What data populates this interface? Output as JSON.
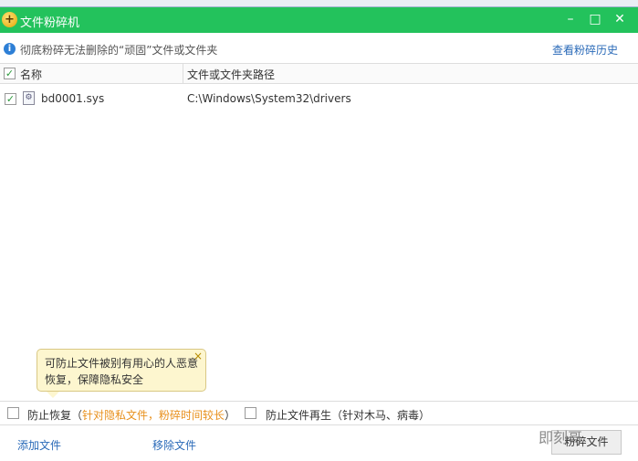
{
  "window": {
    "title": "文件粉碎机",
    "minimize": "–",
    "maximize": "□",
    "close": "✕"
  },
  "info": {
    "text": "彻底粉碎无法删除的“顽固”文件或文件夹",
    "history_link": "查看粉碎历史"
  },
  "table": {
    "columns": [
      "名称",
      "文件或文件夹路径"
    ],
    "rows": [
      {
        "checked": true,
        "name": "bd0001.sys",
        "path": "C:\\Windows\\System32\\drivers"
      }
    ]
  },
  "tooltip": {
    "line1": "可防止文件被别有用心的人恶意",
    "line2": "恢复，保障隐私安全",
    "close": "×"
  },
  "options": {
    "prevent_recovery": "防止恢复（",
    "prevent_recovery_note": "针对隐私文件，粉碎时间较长",
    "prevent_recovery_end": "）",
    "prevent_regen": "防止文件再生（针对木马、病毒）"
  },
  "footer": {
    "add": "添加文件",
    "remove": "移除文件",
    "shred": "粉碎文件"
  },
  "watermark": "即刻哥",
  "colors": {
    "titlebar": "#23c25c",
    "link": "#2a6ab8",
    "note": "#e8901c"
  }
}
